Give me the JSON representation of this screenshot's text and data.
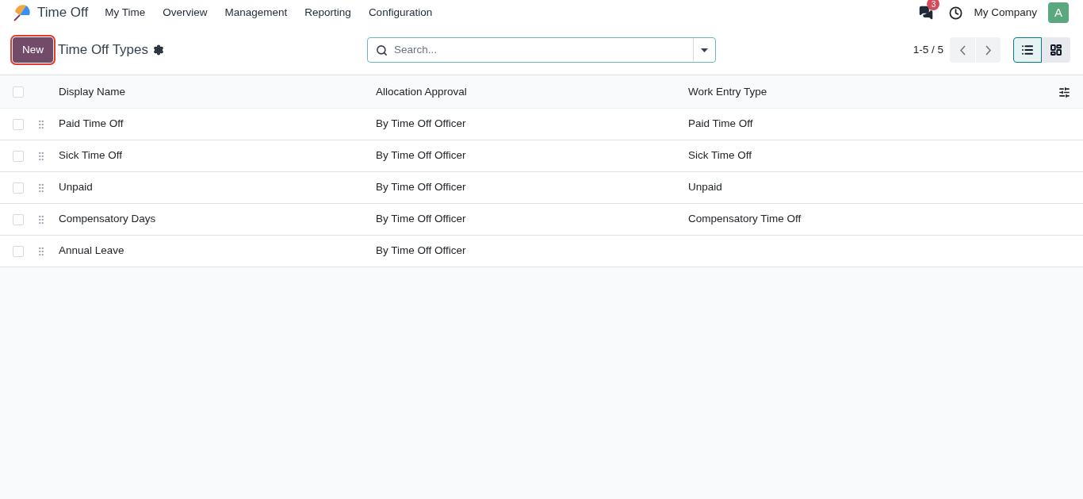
{
  "navbar": {
    "app_name": "Time Off",
    "menu": [
      "My Time",
      "Overview",
      "Management",
      "Reporting",
      "Configuration"
    ],
    "messages_badge": "3",
    "company": "My Company",
    "avatar_letter": "A"
  },
  "control_panel": {
    "new_button": "New",
    "title": "Time Off Types",
    "search": {
      "placeholder": "Search..."
    },
    "pager": "1-5 / 5",
    "views": [
      {
        "kind": "list",
        "selected": true
      },
      {
        "kind": "kanban",
        "selected": false
      }
    ]
  },
  "table": {
    "select_all_checked": false,
    "columns": [
      "Display Name",
      "Allocation Approval",
      "Work Entry Type"
    ],
    "rows": [
      {
        "checked": false,
        "cells": [
          "Paid Time Off",
          "By Time Off Officer",
          "Paid Time Off"
        ]
      },
      {
        "checked": false,
        "cells": [
          "Sick Time Off",
          "By Time Off Officer",
          "Sick Time Off"
        ]
      },
      {
        "checked": false,
        "cells": [
          "Unpaid",
          "By Time Off Officer",
          "Unpaid"
        ]
      },
      {
        "checked": false,
        "cells": [
          "Compensatory Days",
          "By Time Off Officer",
          "Compensatory Time Off"
        ]
      },
      {
        "checked": false,
        "cells": [
          "Annual Leave",
          "By Time Off Officer",
          ""
        ]
      }
    ]
  }
}
